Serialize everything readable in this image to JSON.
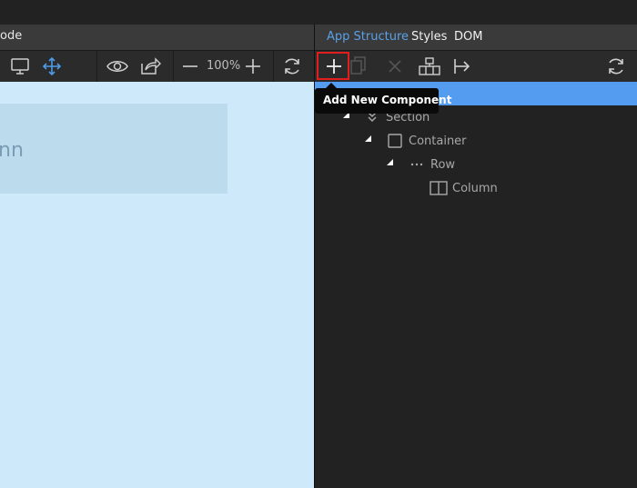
{
  "left_tabs": {
    "label": "ode"
  },
  "left_toolbar": {
    "icons": [
      "monitor-icon",
      "move-icon",
      "eye-icon",
      "share-icon",
      "zoom-out-icon",
      "zoom-in-icon",
      "refresh-icon"
    ],
    "zoom_level": "100%"
  },
  "canvas": {
    "block_text": "nn"
  },
  "right_tabs": {
    "items": [
      {
        "label": "App Structure",
        "active": true
      },
      {
        "label": "Styles",
        "active": false
      },
      {
        "label": "DOM",
        "active": false
      }
    ]
  },
  "right_toolbar": {
    "icons": [
      "add-icon",
      "duplicate-icon",
      "delete-icon",
      "wrap-icon",
      "move-to-icon",
      "refresh-icon"
    ]
  },
  "tooltip": {
    "text": "Add New Component"
  },
  "tree": {
    "items": [
      {
        "label": "Section",
        "icon": "chevrons-icon"
      },
      {
        "label": "Container",
        "icon": "container-icon"
      },
      {
        "label": "Row",
        "icon": "dots-icon"
      },
      {
        "label": "Column",
        "icon": "column-icon"
      }
    ]
  },
  "colors": {
    "accent": "#539cf0",
    "active_tab": "#5aa0e6",
    "highlight_border": "#e21d1d",
    "canvas": "#cde9fa"
  }
}
